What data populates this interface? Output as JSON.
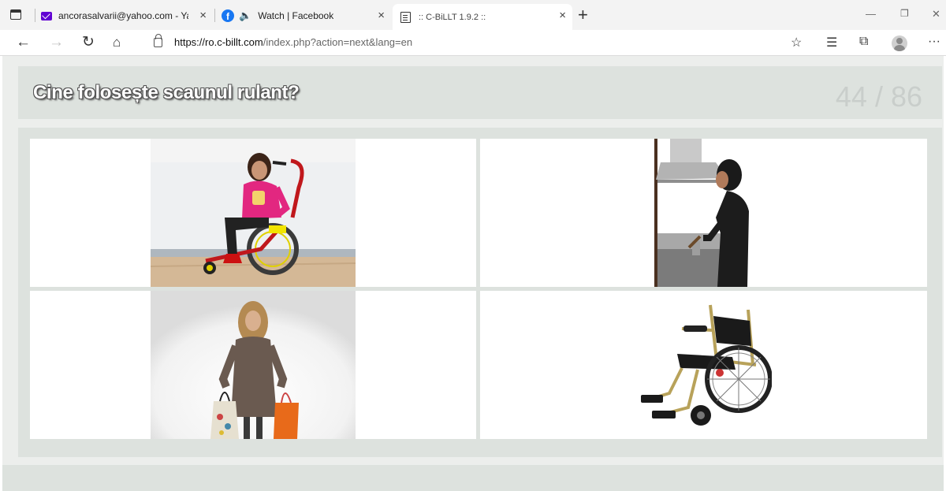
{
  "browser": {
    "tabs": [
      {
        "label": "ancorasalvarii@yahoo.com - Yah",
        "icon": "mail-icon",
        "active": false
      },
      {
        "label": "Watch | Facebook",
        "icon": "facebook-icon",
        "active": false
      },
      {
        "label": ":: C-BiLLT 1.9.2 ::",
        "icon": "reader-icon",
        "active": true
      }
    ],
    "new_tab_symbol": "+",
    "close_symbol": "×",
    "url_host": "https://ro.c-billt.com",
    "url_rest": "/index.php?action=next&lang=en"
  },
  "quiz": {
    "question": "Cine folosește scaunul rulant?",
    "progress": "44 / 86",
    "current": 44,
    "total": 86,
    "options": [
      {
        "picture": "girl-in-pink-on-wheelchair-image"
      },
      {
        "picture": "woman-cooking-at-stove-image"
      },
      {
        "picture": "woman-with-shopping-bags-image"
      },
      {
        "picture": "empty-wheelchair-image"
      }
    ]
  },
  "colors": {
    "panel": "#dde2de",
    "page_bg": "#eceeec",
    "counter": "#c9cecb",
    "yahoo_purple": "#6001d2",
    "facebook_blue": "#1877f2"
  }
}
